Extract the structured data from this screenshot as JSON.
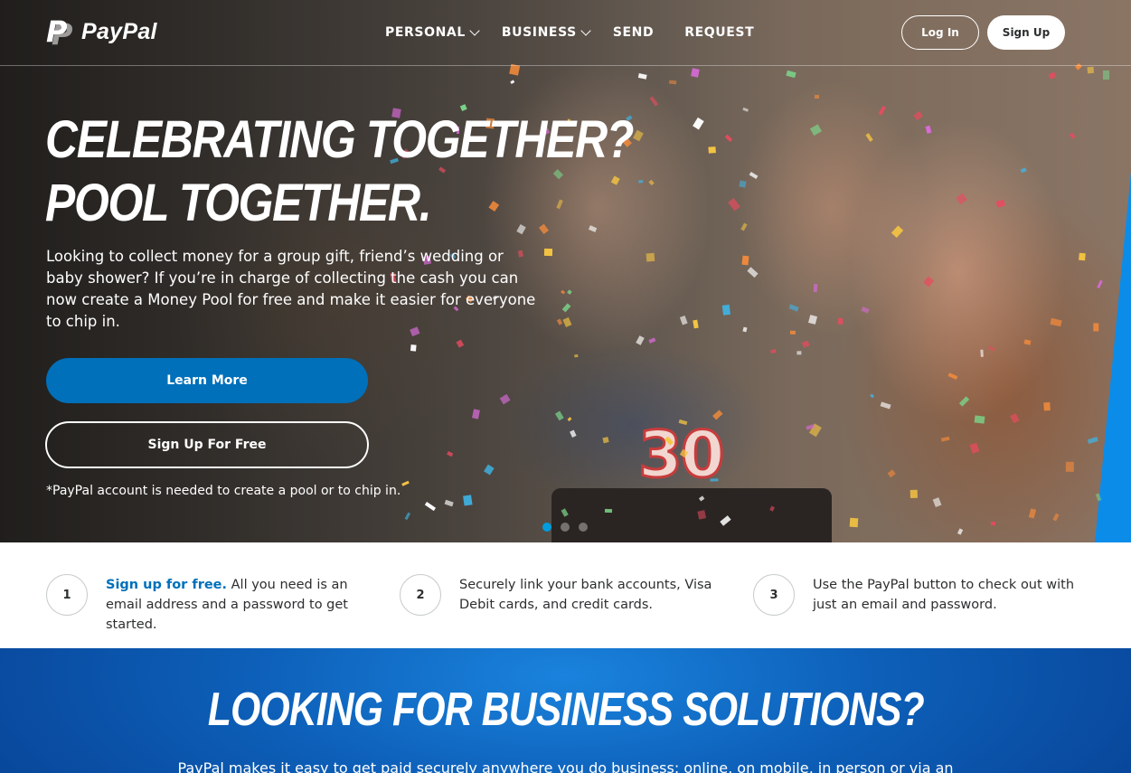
{
  "brand": {
    "name": "PayPal",
    "logo_icon": "paypal-p-logo-icon"
  },
  "nav": {
    "links": [
      {
        "label": "PERSONAL",
        "has_dropdown": true
      },
      {
        "label": "BUSINESS",
        "has_dropdown": true
      },
      {
        "label": "SEND",
        "has_dropdown": false
      },
      {
        "label": "REQUEST",
        "has_dropdown": false
      }
    ],
    "login_label": "Log In",
    "signup_label": "Sign Up"
  },
  "hero": {
    "title_line1": "CELEBRATING TOGETHER?",
    "title_line2": "POOL TOGETHER.",
    "description": "Looking to collect money for a group gift, friend’s wedding or baby shower? If you’re in charge of collecting the cash you can now create a Money Pool for free and make it easier for everyone to chip in.",
    "learn_more_label": "Learn More",
    "signup_free_label": "Sign Up For Free",
    "note": "*PayPal account is needed to create a pool or to chip in.",
    "candle_number": "30",
    "carousel": {
      "slides": 3,
      "active_index": 0
    }
  },
  "steps": [
    {
      "number": "1",
      "link_text": "Sign up for free.",
      "text": " All you need is an email address and a password to get started."
    },
    {
      "number": "2",
      "link_text": "",
      "text": "Securely link your bank accounts, Visa Debit cards, and credit cards."
    },
    {
      "number": "3",
      "link_text": "",
      "text": "Use the PayPal button to check out with just an email and password."
    }
  ],
  "business": {
    "title": "LOOKING FOR BUSINESS SOLUTIONS?",
    "description": "PayPal makes it easy to get paid securely anywhere you do business: online, on mobile, in person or via an"
  },
  "colors": {
    "primary_blue": "#0070ba",
    "accent_blue": "#009cde",
    "business_bg": "#0d5fb8",
    "text_dark": "#2c2e2f"
  }
}
